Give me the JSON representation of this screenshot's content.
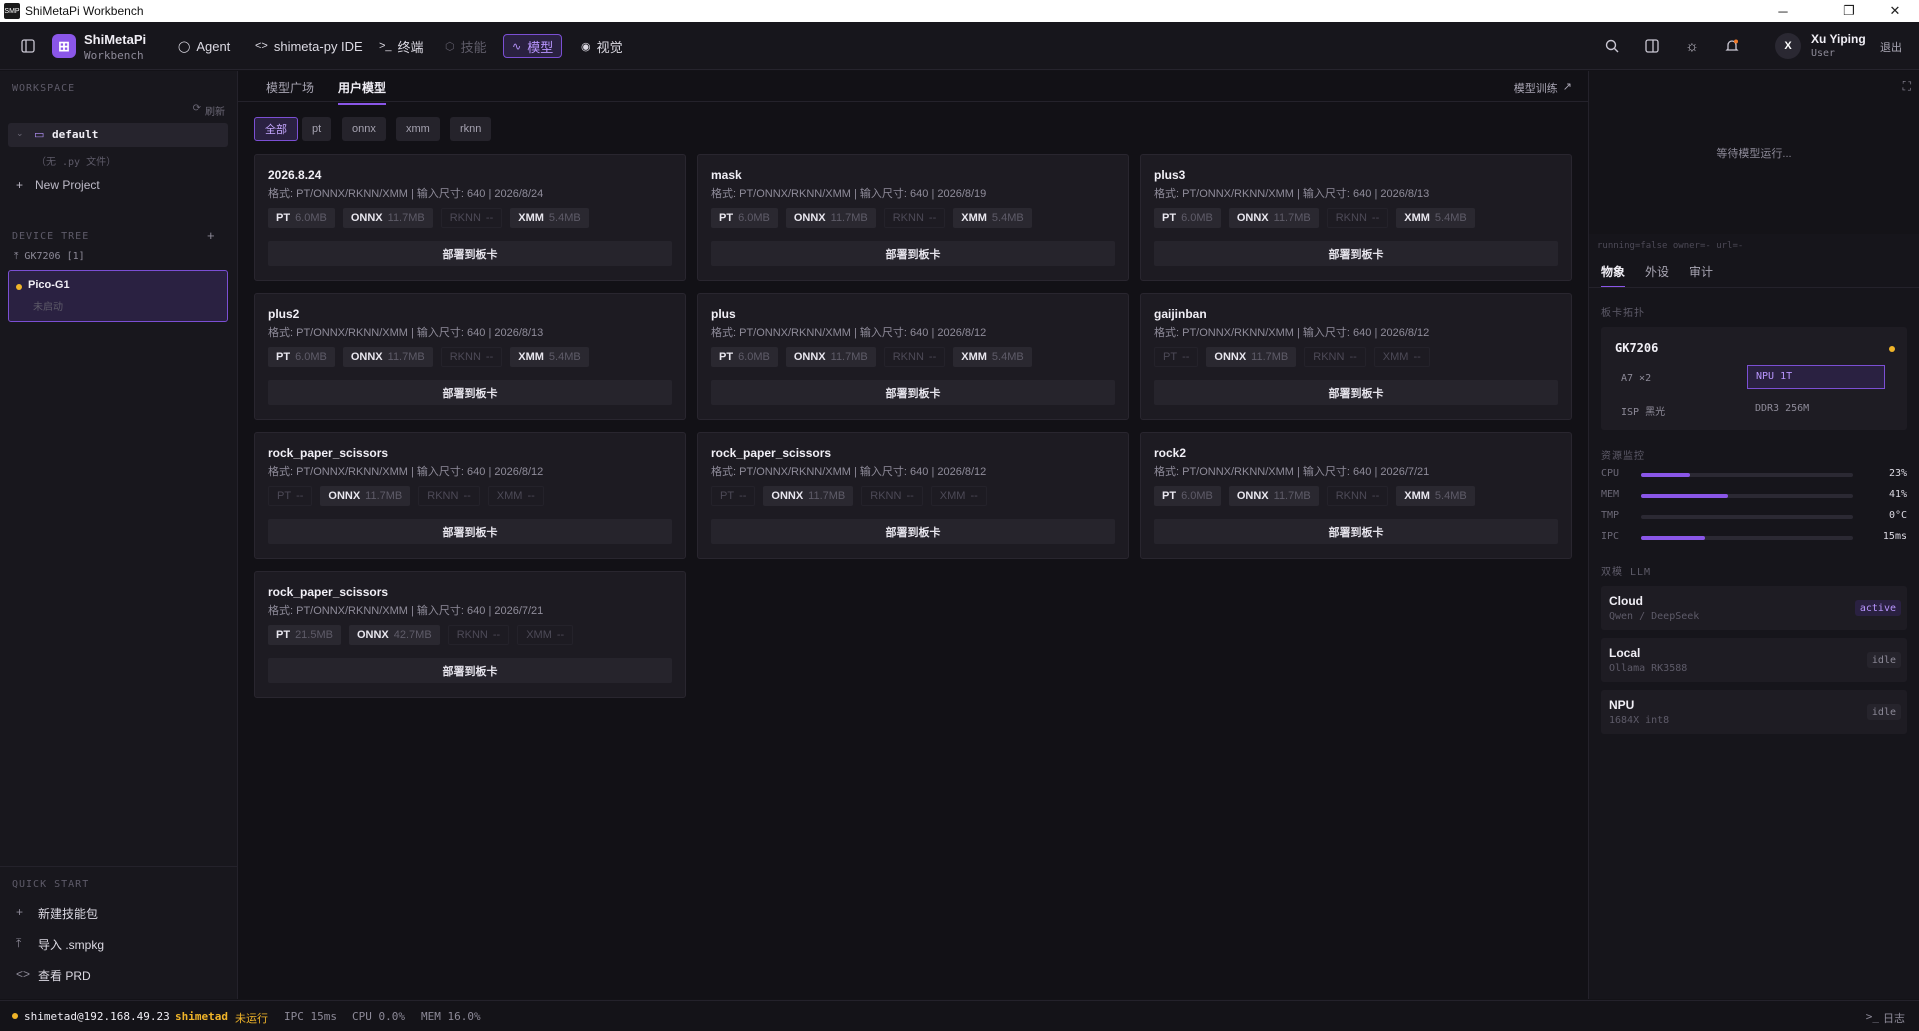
{
  "window": {
    "title": "ShiMetaPi Workbench",
    "icon_label": "SMP",
    "min": "─",
    "max": "❐",
    "close": "✕"
  },
  "brand": {
    "name": "ShiMetaPi",
    "sub": "Workbench"
  },
  "nav": [
    {
      "label": "Agent",
      "icon": "◯",
      "state": "normal"
    },
    {
      "label": "shimeta-py IDE",
      "icon": "<>",
      "state": "normal"
    },
    {
      "label": "终端",
      "icon": ">_",
      "state": "normal"
    },
    {
      "label": "技能",
      "icon": "⬡",
      "state": "disabled"
    },
    {
      "label": "模型",
      "icon": "∿",
      "state": "active"
    },
    {
      "label": "视觉",
      "icon": "◉",
      "state": "normal"
    }
  ],
  "user": {
    "initial": "X",
    "name": "Xu Yiping",
    "role": "User",
    "logout": "退出"
  },
  "sidebar": {
    "workspace_title": "WORKSPACE",
    "refresh": "刷新",
    "project": "default",
    "project_hint": "（无 .py 文件）",
    "new_project": "New Project",
    "device_title": "DEVICE TREE",
    "device_add": "+",
    "device_parent": "GK7206 [1]",
    "device_name": "Pico-G1",
    "device_status": "未启动",
    "quick_title": "QUICK START",
    "quick": [
      {
        "icon": "+",
        "label": "新建技能包"
      },
      {
        "icon": "⤒",
        "label": "导入 .smpkg"
      },
      {
        "icon": "<>",
        "label": "查看 PRD"
      }
    ]
  },
  "main": {
    "tabs": [
      {
        "label": "模型广场",
        "active": false
      },
      {
        "label": "用户模型",
        "active": true
      }
    ],
    "train_link": "模型训练",
    "filters": [
      {
        "label": "全部",
        "active": true
      },
      {
        "label": "pt",
        "active": false
      },
      {
        "label": "onnx",
        "active": false
      },
      {
        "label": "xmm",
        "active": false
      },
      {
        "label": "rknn",
        "active": false
      }
    ],
    "deploy_label": "部署到板卡",
    "models": [
      {
        "name": "2026.8.24",
        "meta": "格式: PT/ONNX/RKNN/XMM | 输入尺寸: 640 | 2026/8/24",
        "formats": [
          {
            "k": "PT",
            "s": "6.0MB",
            "on": true
          },
          {
            "k": "ONNX",
            "s": "11.7MB",
            "on": true
          },
          {
            "k": "RKNN",
            "s": "--",
            "on": false
          },
          {
            "k": "XMM",
            "s": "5.4MB",
            "on": true
          }
        ]
      },
      {
        "name": "mask",
        "meta": "格式: PT/ONNX/RKNN/XMM | 输入尺寸: 640 | 2026/8/19",
        "formats": [
          {
            "k": "PT",
            "s": "6.0MB",
            "on": true
          },
          {
            "k": "ONNX",
            "s": "11.7MB",
            "on": true
          },
          {
            "k": "RKNN",
            "s": "--",
            "on": false
          },
          {
            "k": "XMM",
            "s": "5.4MB",
            "on": true
          }
        ]
      },
      {
        "name": "plus3",
        "meta": "格式: PT/ONNX/RKNN/XMM | 输入尺寸: 640 | 2026/8/13",
        "formats": [
          {
            "k": "PT",
            "s": "6.0MB",
            "on": true
          },
          {
            "k": "ONNX",
            "s": "11.7MB",
            "on": true
          },
          {
            "k": "RKNN",
            "s": "--",
            "on": false
          },
          {
            "k": "XMM",
            "s": "5.4MB",
            "on": true
          }
        ]
      },
      {
        "name": "plus2",
        "meta": "格式: PT/ONNX/RKNN/XMM | 输入尺寸: 640 | 2026/8/13",
        "formats": [
          {
            "k": "PT",
            "s": "6.0MB",
            "on": true
          },
          {
            "k": "ONNX",
            "s": "11.7MB",
            "on": true
          },
          {
            "k": "RKNN",
            "s": "--",
            "on": false
          },
          {
            "k": "XMM",
            "s": "5.4MB",
            "on": true
          }
        ]
      },
      {
        "name": "plus",
        "meta": "格式: PT/ONNX/RKNN/XMM | 输入尺寸: 640 | 2026/8/12",
        "formats": [
          {
            "k": "PT",
            "s": "6.0MB",
            "on": true
          },
          {
            "k": "ONNX",
            "s": "11.7MB",
            "on": true
          },
          {
            "k": "RKNN",
            "s": "--",
            "on": false
          },
          {
            "k": "XMM",
            "s": "5.4MB",
            "on": true
          }
        ]
      },
      {
        "name": "gaijinban",
        "meta": "格式: PT/ONNX/RKNN/XMM | 输入尺寸: 640 | 2026/8/12",
        "formats": [
          {
            "k": "PT",
            "s": "--",
            "on": false
          },
          {
            "k": "ONNX",
            "s": "11.7MB",
            "on": true
          },
          {
            "k": "RKNN",
            "s": "--",
            "on": false
          },
          {
            "k": "XMM",
            "s": "--",
            "on": false
          }
        ]
      },
      {
        "name": "rock_paper_scissors",
        "meta": "格式: PT/ONNX/RKNN/XMM | 输入尺寸: 640 | 2026/8/12",
        "formats": [
          {
            "k": "PT",
            "s": "--",
            "on": false
          },
          {
            "k": "ONNX",
            "s": "11.7MB",
            "on": true
          },
          {
            "k": "RKNN",
            "s": "--",
            "on": false
          },
          {
            "k": "XMM",
            "s": "--",
            "on": false
          }
        ]
      },
      {
        "name": "rock_paper_scissors",
        "meta": "格式: PT/ONNX/RKNN/XMM | 输入尺寸: 640 | 2026/8/12",
        "formats": [
          {
            "k": "PT",
            "s": "--",
            "on": false
          },
          {
            "k": "ONNX",
            "s": "11.7MB",
            "on": true
          },
          {
            "k": "RKNN",
            "s": "--",
            "on": false
          },
          {
            "k": "XMM",
            "s": "--",
            "on": false
          }
        ]
      },
      {
        "name": "rock2",
        "meta": "格式: PT/ONNX/RKNN/XMM | 输入尺寸: 640 | 2026/7/21",
        "formats": [
          {
            "k": "PT",
            "s": "6.0MB",
            "on": true
          },
          {
            "k": "ONNX",
            "s": "11.7MB",
            "on": true
          },
          {
            "k": "RKNN",
            "s": "--",
            "on": false
          },
          {
            "k": "XMM",
            "s": "5.4MB",
            "on": true
          }
        ]
      },
      {
        "name": "rock_paper_scissors",
        "meta": "格式: PT/ONNX/RKNN/XMM | 输入尺寸: 640 | 2026/7/21",
        "formats": [
          {
            "k": "PT",
            "s": "21.5MB",
            "on": true
          },
          {
            "k": "ONNX",
            "s": "42.7MB",
            "on": true
          },
          {
            "k": "RKNN",
            "s": "--",
            "on": false
          },
          {
            "k": "XMM",
            "s": "--",
            "on": false
          }
        ]
      }
    ]
  },
  "right": {
    "waiting": "等待模型运行...",
    "status_line": "running=false owner=- url=-",
    "tabs": [
      {
        "label": "物象",
        "active": true
      },
      {
        "label": "外设",
        "active": false
      },
      {
        "label": "审计",
        "active": false
      }
    ],
    "board_title": "板卡拓扑",
    "board_name": "GK7206",
    "board_specs": [
      "A7 ×2",
      "NPU 1T",
      "ISP 黑光",
      "DDR3 256M"
    ],
    "res_title": "资源监控",
    "metrics": [
      {
        "label": "CPU",
        "value": "23%",
        "fraction": 0.23
      },
      {
        "label": "MEM",
        "value": "41%",
        "fraction": 0.41
      },
      {
        "label": "TMP",
        "value": "0°C",
        "fraction": 0
      },
      {
        "label": "IPC",
        "value": "15ms",
        "fraction": 0.3
      }
    ],
    "llm_title": "双模 LLM",
    "llms": [
      {
        "title": "Cloud",
        "desc": "Qwen / DeepSeek",
        "badge": "active"
      },
      {
        "title": "Local",
        "desc": "Ollama RK3588",
        "badge": "idle"
      },
      {
        "title": "NPU",
        "desc": "1684X int8",
        "badge": "idle"
      }
    ]
  },
  "status": {
    "host": "shimetad@192.168.49.23",
    "svc": "shimetad",
    "svc_state": "未运行",
    "ipc": "IPC 15ms",
    "cpu": "CPU 0.0%",
    "mem": "MEM 16.0%",
    "log": "日志"
  },
  "colors": {
    "accent": "#8a56e8",
    "warn": "#f0b429",
    "bg": "#131217"
  }
}
